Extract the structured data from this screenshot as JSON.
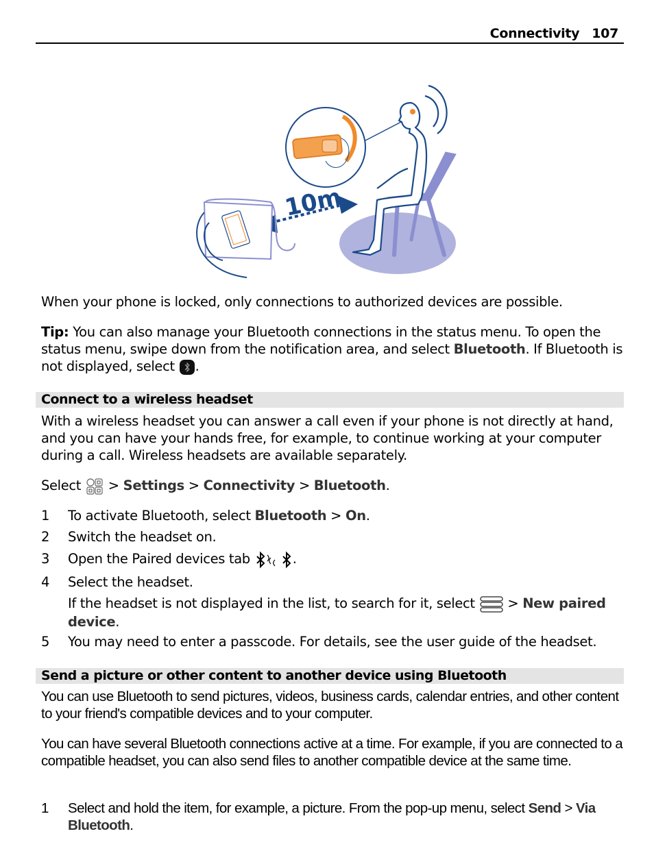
{
  "header": {
    "section": "Connectivity",
    "page": "107"
  },
  "illustration": {
    "label": "10m",
    "alt": "Person sitting on chair wearing Bluetooth headset, phone in bag 10m away"
  },
  "intro": "When your phone is locked, only connections to authorized devices are possible.",
  "tip": {
    "label": "Tip:",
    "text1": " You can also manage your Bluetooth connections in the status menu. To open the status menu, swipe down from the notification area, and select ",
    "bold1": "Bluetooth",
    "text2": ". If Bluetooth is not displayed, select ",
    "text3": "."
  },
  "section1": {
    "heading": "Connect to a wireless headset",
    "body": "With a wireless headset you can answer a call even if your phone is not directly at hand, and you can have your hands free, for example, to continue working at your computer during a call. Wireless headsets are available separately.",
    "path": {
      "select": "Select",
      "sep": " > ",
      "items": [
        "Settings",
        "Connectivity",
        "Bluetooth"
      ],
      "end": "."
    },
    "steps": [
      {
        "num": "1",
        "text": "To activate Bluetooth, select ",
        "bold": "Bluetooth",
        "sep": "  > ",
        "bold2": "On",
        "end": "."
      },
      {
        "num": "2",
        "text": "Switch the headset on."
      },
      {
        "num": "3",
        "text": "Open the Paired devices tab ",
        "end": "."
      },
      {
        "num": "4",
        "text": "Select the headset."
      },
      {
        "num": "",
        "text": "If the headset is not displayed in the list, to search for it, select ",
        "sep": " > ",
        "bold": "New paired device",
        "end": "."
      },
      {
        "num": "5",
        "text": "You may need to enter a passcode. For details, see the user guide of the headset."
      }
    ]
  },
  "section2": {
    "heading": "Send a picture or other content to another device using Bluetooth",
    "para1": "You can use Bluetooth to send pictures, videos, business cards, calendar entries, and other content to your friend's compatible devices and to your computer.",
    "para2": "You can have several Bluetooth connections active at a time. For example, if you are connected to a compatible headset, you can also send files to another compatible device at the same time.",
    "steps": [
      {
        "num": "1",
        "text": "Select and hold the item, for example, a picture. From the pop-up menu, select ",
        "bold": "Send",
        "sep": "  > ",
        "bold2": "Via Bluetooth",
        "end": "."
      }
    ]
  },
  "colors": {
    "illus_blue": "#1a4a8a",
    "chair": "#8b8fd0",
    "floor": "#b0b3dd",
    "orange": "#f08a2c",
    "heading_bar": "#e4e4e4"
  }
}
